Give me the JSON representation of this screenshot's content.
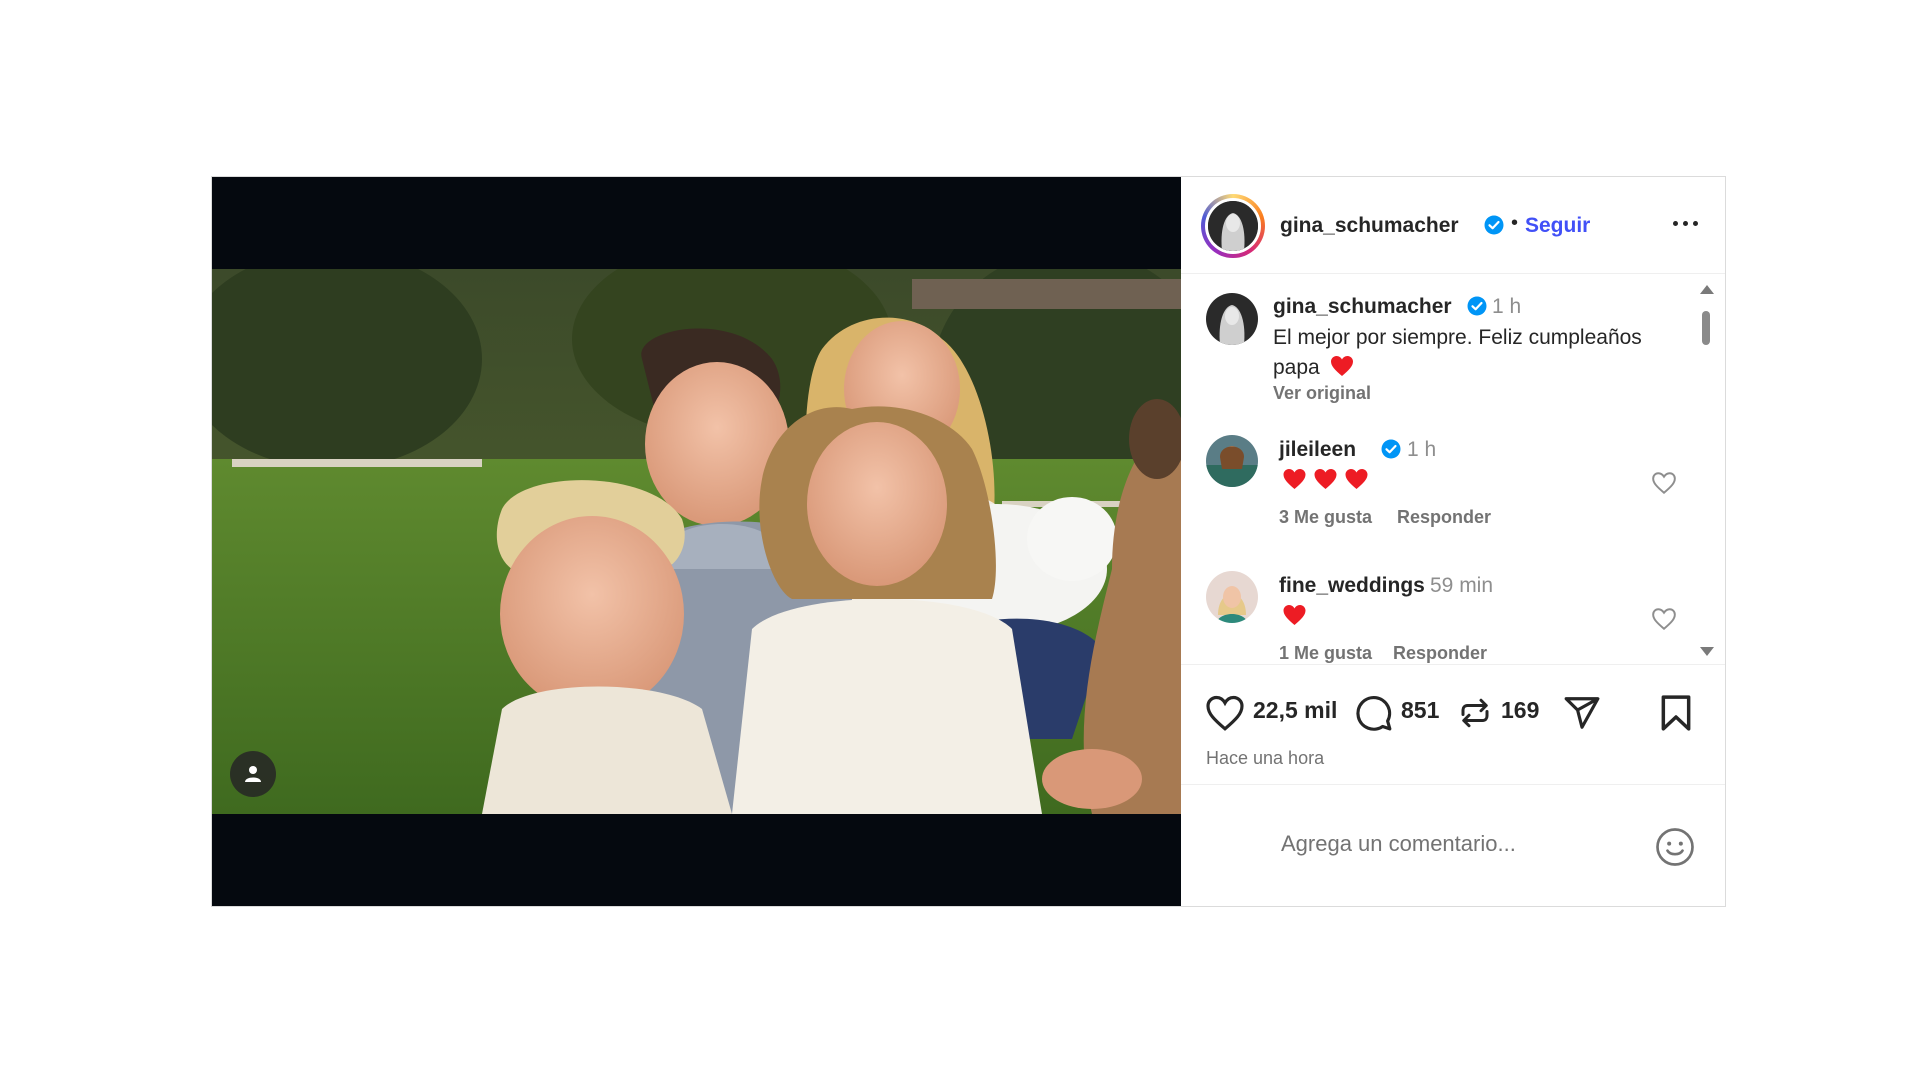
{
  "header": {
    "username": "gina_schumacher",
    "separator": "•",
    "follow_label": "Seguir",
    "more_icon": "more-horizontal-icon"
  },
  "caption": {
    "username": "gina_schumacher",
    "time": "1 h",
    "text": "El mejor por siempre. Feliz cumpleaños papa",
    "emoji": "red-heart",
    "see_original": "Ver original"
  },
  "comments": [
    {
      "username": "jileileen",
      "verified": true,
      "time": "1 h",
      "hearts": 3,
      "likes": "3 Me gusta",
      "reply": "Responder"
    },
    {
      "username": "fine_weddings",
      "verified": false,
      "time": "59 min",
      "hearts": 1,
      "likes": "1 Me gusta",
      "reply": "Responder"
    }
  ],
  "actions": {
    "likes": "22,5 mil",
    "comments": "851",
    "reposts": "169",
    "posted": "Hace una hora"
  },
  "add_comment": {
    "placeholder": "Agrega un comentario..."
  },
  "colors": {
    "accent": "#4150f7",
    "verified": "#0095f6",
    "heart": "#ed1c24",
    "text": "#262626",
    "secondary": "#737373"
  }
}
